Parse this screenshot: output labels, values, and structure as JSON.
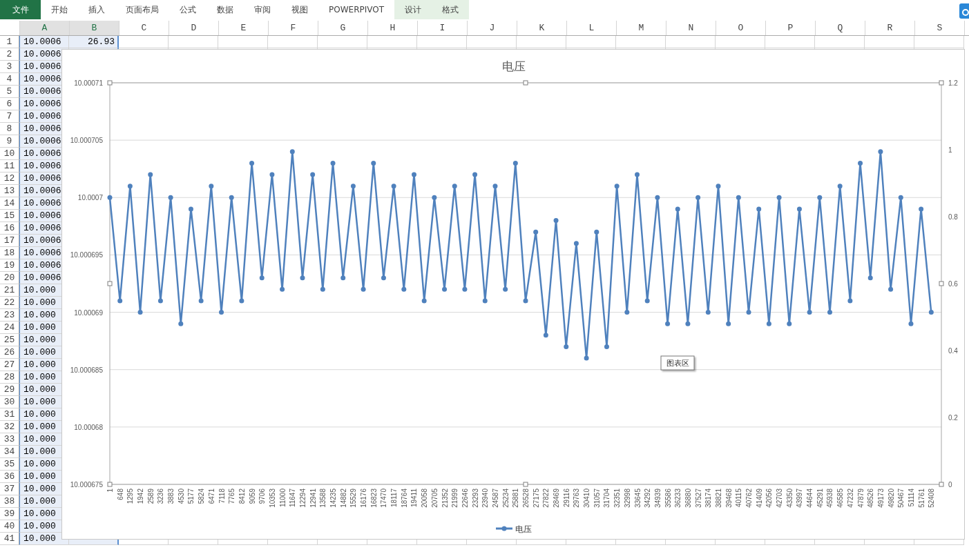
{
  "ribbon": {
    "tabs": [
      {
        "label": "文件",
        "kind": "file"
      },
      {
        "label": "开始",
        "kind": "plain"
      },
      {
        "label": "插入",
        "kind": "plain"
      },
      {
        "label": "页面布局",
        "kind": "plain"
      },
      {
        "label": "公式",
        "kind": "plain"
      },
      {
        "label": "数据",
        "kind": "plain"
      },
      {
        "label": "审阅",
        "kind": "plain"
      },
      {
        "label": "视图",
        "kind": "plain"
      },
      {
        "label": "POWERPIVOT",
        "kind": "plain"
      },
      {
        "label": "设计",
        "kind": "context"
      },
      {
        "label": "格式",
        "kind": "context"
      }
    ]
  },
  "sheet": {
    "columns": [
      "A",
      "B",
      "C",
      "D",
      "E",
      "F",
      "G",
      "H",
      "I",
      "J",
      "K",
      "L",
      "M",
      "N",
      "O",
      "P",
      "Q",
      "R",
      "S"
    ],
    "rows": [
      {
        "number": "1",
        "a": "10.0006",
        "b": "26.93"
      },
      {
        "number": "2",
        "a": "10.0006"
      },
      {
        "number": "3",
        "a": "10.0006"
      },
      {
        "number": "4",
        "a": "10.0006"
      },
      {
        "number": "5",
        "a": "10.0006"
      },
      {
        "number": "6",
        "a": "10.0006"
      },
      {
        "number": "7",
        "a": "10.0006"
      },
      {
        "number": "8",
        "a": "10.0006"
      },
      {
        "number": "9",
        "a": "10.0006"
      },
      {
        "number": "10",
        "a": "10.0006"
      },
      {
        "number": "11",
        "a": "10.0006"
      },
      {
        "number": "12",
        "a": "10.0006"
      },
      {
        "number": "13",
        "a": "10.0006"
      },
      {
        "number": "14",
        "a": "10.0006"
      },
      {
        "number": "15",
        "a": "10.0006"
      },
      {
        "number": "16",
        "a": "10.0006"
      },
      {
        "number": "17",
        "a": "10.0006"
      },
      {
        "number": "18",
        "a": "10.0006"
      },
      {
        "number": "19",
        "a": "10.0006"
      },
      {
        "number": "20",
        "a": "10.0006"
      },
      {
        "number": "21",
        "a": "10.000"
      },
      {
        "number": "22",
        "a": "10.000"
      },
      {
        "number": "23",
        "a": "10.000"
      },
      {
        "number": "24",
        "a": "10.000"
      },
      {
        "number": "25",
        "a": "10.000"
      },
      {
        "number": "26",
        "a": "10.000"
      },
      {
        "number": "27",
        "a": "10.000"
      },
      {
        "number": "28",
        "a": "10.000"
      },
      {
        "number": "29",
        "a": "10.000"
      },
      {
        "number": "30",
        "a": "10.000"
      },
      {
        "number": "31",
        "a": "10.000"
      },
      {
        "number": "32",
        "a": "10.000"
      },
      {
        "number": "33",
        "a": "10.000"
      },
      {
        "number": "34",
        "a": "10.000"
      },
      {
        "number": "35",
        "a": "10.000"
      },
      {
        "number": "36",
        "a": "10.000"
      },
      {
        "number": "37",
        "a": "10.000"
      },
      {
        "number": "38",
        "a": "10.000"
      },
      {
        "number": "39",
        "a": "10.000"
      },
      {
        "number": "40",
        "a": "10.000"
      },
      {
        "number": "41",
        "a": "10.000"
      }
    ]
  },
  "chart": {
    "tooltip": "图表区",
    "secondary_axis": {
      "ticks": [
        "1.2",
        "1",
        "0.8",
        "0.6",
        "0.4",
        "0.2",
        "0"
      ]
    },
    "chart_data": {
      "type": "line",
      "title": "电压",
      "categories": [
        "1",
        "648",
        "1295",
        "1942",
        "2589",
        "3236",
        "3883",
        "4530",
        "5177",
        "5824",
        "6471",
        "7118",
        "7765",
        "8412",
        "9059",
        "9706",
        "10353",
        "11000",
        "11647",
        "12294",
        "12941",
        "13588",
        "14235",
        "14882",
        "15529",
        "16176",
        "16823",
        "17470",
        "18117",
        "18764",
        "19411",
        "20058",
        "20705",
        "21352",
        "21999",
        "22646",
        "23293",
        "23940",
        "24587",
        "25234",
        "25881",
        "26528",
        "27175",
        "27822",
        "28469",
        "29116",
        "29763",
        "30410",
        "31057",
        "31704",
        "32351",
        "32998",
        "33645",
        "34292",
        "34939",
        "35586",
        "36233",
        "36880",
        "37527",
        "38174",
        "38821",
        "39468",
        "40115",
        "40762",
        "41409",
        "42056",
        "42703",
        "43350",
        "43997",
        "44644",
        "45291",
        "45938",
        "46585",
        "47232",
        "47879",
        "48526",
        "49173",
        "49820",
        "50467",
        "51114",
        "51761",
        "52408"
      ],
      "series": [
        {
          "name": "电压",
          "color": "#4f81bd",
          "marker": "circle",
          "values": [
            10.0007,
            10.000691,
            10.000701,
            10.00069,
            10.000702,
            10.000691,
            10.0007,
            10.000689,
            10.000699,
            10.000691,
            10.000701,
            10.00069,
            10.0007,
            10.000691,
            10.000703,
            10.000693,
            10.000702,
            10.000692,
            10.000704,
            10.000693,
            10.000702,
            10.000692,
            10.000703,
            10.000693,
            10.000701,
            10.000692,
            10.000703,
            10.000693,
            10.000701,
            10.000692,
            10.000702,
            10.000691,
            10.0007,
            10.000692,
            10.000701,
            10.000692,
            10.000702,
            10.000691,
            10.000701,
            10.000692,
            10.000703,
            10.000691,
            10.000697,
            10.000688,
            10.000698,
            10.000687,
            10.000696,
            10.000686,
            10.000697,
            10.000687,
            10.000701,
            10.00069,
            10.000702,
            10.000691,
            10.0007,
            10.000689,
            10.000699,
            10.000689,
            10.0007,
            10.00069,
            10.000701,
            10.000689,
            10.0007,
            10.00069,
            10.000699,
            10.000689,
            10.0007,
            10.000689,
            10.000699,
            10.00069,
            10.0007,
            10.00069,
            10.000701,
            10.000691,
            10.000703,
            10.000693,
            10.000704,
            10.000692,
            10.0007,
            10.000689,
            10.000699,
            10.00069
          ]
        }
      ],
      "grid": true,
      "ylim": [
        10.000675,
        10.00071
      ],
      "yticks": [
        {
          "value": 10.00071,
          "label": "10.00071"
        },
        {
          "value": 10.000705,
          "label": "10.000705"
        },
        {
          "value": 10.0007,
          "label": "10.0007"
        },
        {
          "value": 10.000695,
          "label": "10.000695"
        },
        {
          "value": 10.00069,
          "label": "10.00069"
        },
        {
          "value": 10.000685,
          "label": "10.000685"
        },
        {
          "value": 10.00068,
          "label": "10.00068"
        },
        {
          "value": 10.000675,
          "label": "10.000675"
        }
      ]
    }
  }
}
